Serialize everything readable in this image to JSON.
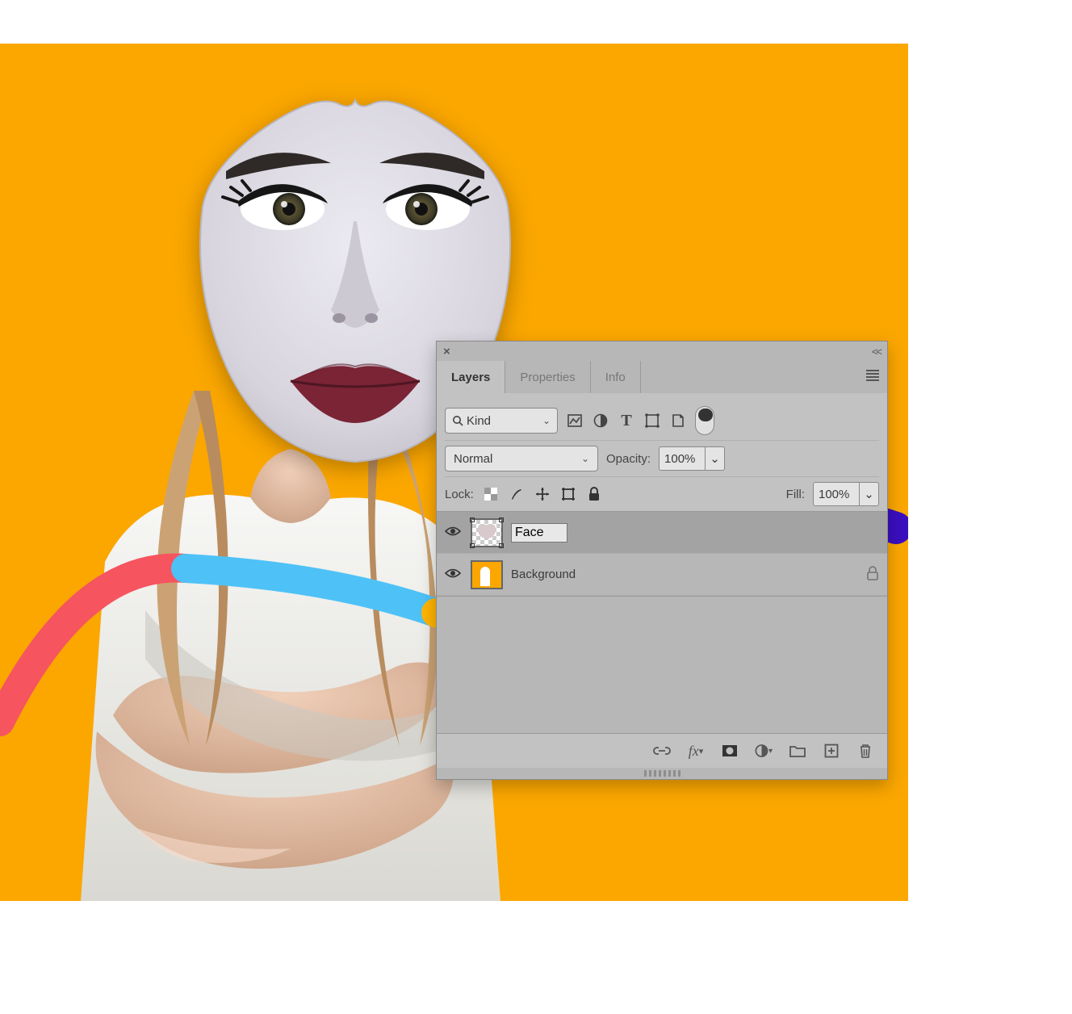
{
  "tabs": {
    "layers": "Layers",
    "properties": "Properties",
    "info": "Info"
  },
  "filter": {
    "kind": "Kind"
  },
  "blend": {
    "mode": "Normal"
  },
  "labels": {
    "opacity": "Opacity:",
    "lock": "Lock:",
    "fill": "Fill:"
  },
  "values": {
    "opacity": "100%",
    "fill": "100%"
  },
  "layers": {
    "face": {
      "name": "Face"
    },
    "background": {
      "name": "Background"
    }
  }
}
